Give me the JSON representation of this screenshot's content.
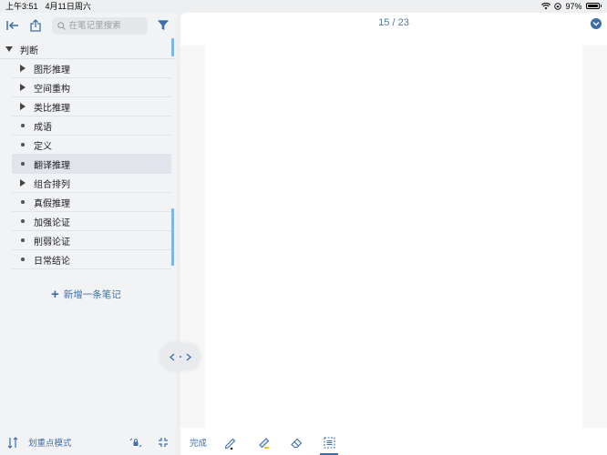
{
  "status_bar": {
    "time": "上午3:51",
    "date": "4月11日周六",
    "battery": "97%"
  },
  "sidebar": {
    "search_placeholder": "在笔记里搜索",
    "root": {
      "label": "判断"
    },
    "items": [
      {
        "label": "图形推理",
        "type": "expandable"
      },
      {
        "label": "空间重构",
        "type": "expandable"
      },
      {
        "label": "类比推理",
        "type": "expandable"
      },
      {
        "label": "成语",
        "type": "leaf"
      },
      {
        "label": "定义",
        "type": "leaf"
      },
      {
        "label": "翻译推理",
        "type": "leaf",
        "selected": true
      },
      {
        "label": "组合排列",
        "type": "expandable"
      },
      {
        "label": "真假推理",
        "type": "leaf"
      },
      {
        "label": "加强论证",
        "type": "leaf"
      },
      {
        "label": "削弱论证",
        "type": "leaf"
      },
      {
        "label": "日常结论",
        "type": "leaf"
      }
    ],
    "add_note_label": "新增一条笔记",
    "highlight_mode_label": "划重点模式"
  },
  "viewer": {
    "page_indicator": "15 / 23",
    "done_label": "完成"
  },
  "colors": {
    "accent": "#3d6ea7",
    "scroll_indicator": "#7fb6e8",
    "selected_row": "#e1e4ea"
  }
}
